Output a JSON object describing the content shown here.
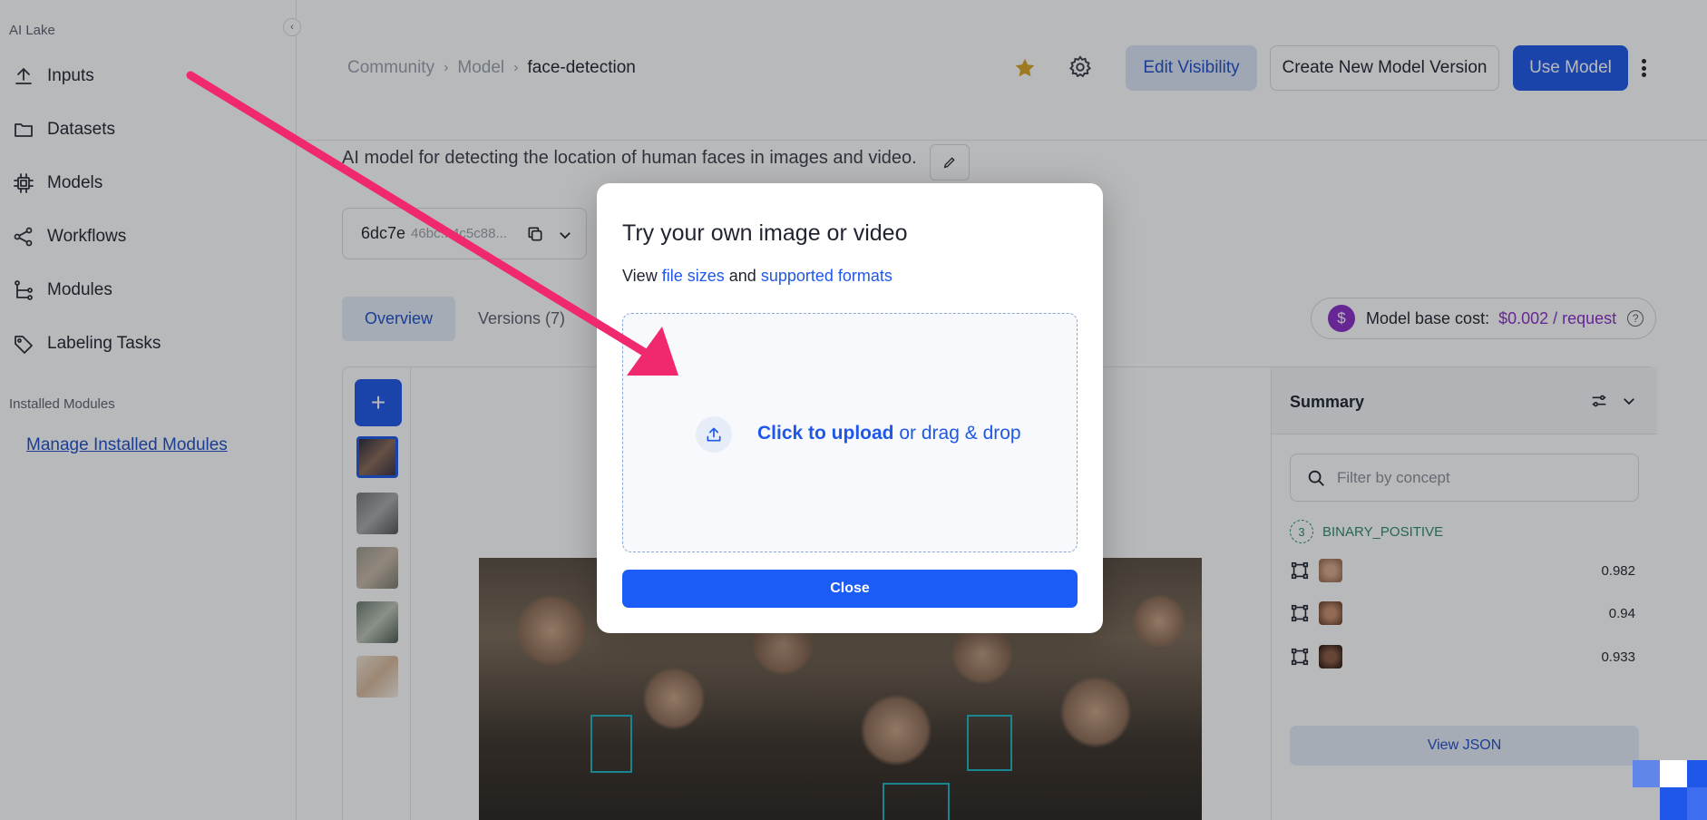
{
  "sidebar": {
    "org_label": "AI Lake",
    "items": [
      {
        "label": "Inputs",
        "icon": "upload-icon"
      },
      {
        "label": "Datasets",
        "icon": "folder-icon"
      },
      {
        "label": "Models",
        "icon": "chip-icon"
      },
      {
        "label": "Workflows",
        "icon": "share-nodes-icon"
      },
      {
        "label": "Modules",
        "icon": "tree-icon"
      },
      {
        "label": "Labeling Tasks",
        "icon": "tag-icon"
      }
    ],
    "installed_label": "Installed Modules",
    "manage_link": "Manage Installed Modules"
  },
  "header": {
    "breadcrumb": [
      "Community",
      "Model",
      "face-detection"
    ],
    "edit_visibility": "Edit Visibility",
    "create_version": "Create New Model Version",
    "use_model": "Use Model"
  },
  "main": {
    "description": "AI model for detecting the location of human faces in images and video.",
    "version_id": "6dc7e",
    "version_hash": "46bc...4c5c88...",
    "tabs": [
      {
        "label": "Overview",
        "active": true
      },
      {
        "label": "Versions (7)",
        "active": false
      }
    ],
    "cost_label": "Model base cost:",
    "cost_value": "$0.002 / request",
    "cost_icon": "$"
  },
  "summary": {
    "title": "Summary",
    "filter_placeholder": "Filter by concept",
    "concept_count": "3",
    "concept_name": "BINARY_POSITIVE",
    "predictions": [
      {
        "score": "0.982"
      },
      {
        "score": "0.94"
      },
      {
        "score": "0.933"
      }
    ],
    "view_json": "View JSON"
  },
  "modal": {
    "title": "Try your own image or video",
    "sub_prefix": "View",
    "sub_link1": "file sizes",
    "sub_mid": "and",
    "sub_link2": "supported formats",
    "upload_strong": "Click to upload",
    "upload_rest": "or drag & drop",
    "close_label": "Close"
  },
  "colors": {
    "primary": "#1f58e8",
    "annotation_arrow": "#f0286e",
    "box": "#1bb5c4",
    "cost": "#8a2fc9",
    "star": "#d8a521"
  }
}
